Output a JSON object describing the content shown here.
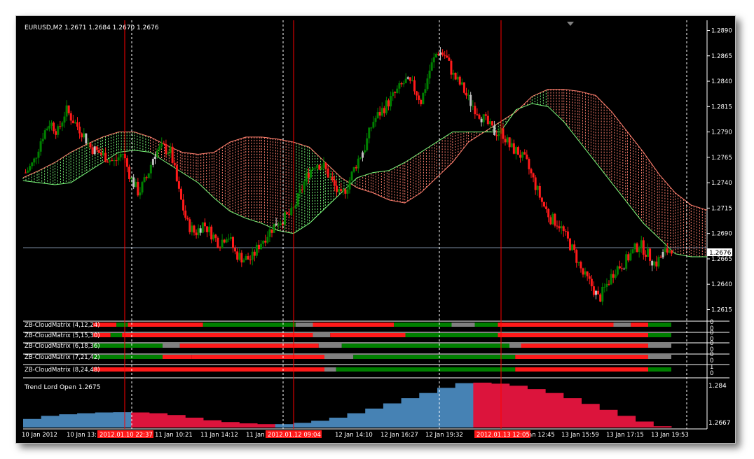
{
  "window": {
    "symbol_header": "EURUSD,M2  1.2671  1.2684  1.2670  1.2676"
  },
  "colors": {
    "background": "#000000",
    "bull_candle": "#008000",
    "bear_candle": "#ff1a1a",
    "neutral_candle": "#c0c0c0",
    "cloud_bull": "#7cfc7c",
    "cloud_bear": "#ff7f6e",
    "matrix_green": "#008000",
    "matrix_red": "#ff1a1a",
    "matrix_gray": "#808080",
    "trend_blue": "#4682b4",
    "trend_red": "#dc143c",
    "vline_red": "#ff0000"
  },
  "price_axis": {
    "ticks": [
      "1.2890",
      "1.2865",
      "1.2840",
      "1.2815",
      "1.2790",
      "1.2765",
      "1.2740",
      "1.2715",
      "1.2690",
      "1.2665",
      "1.2640",
      "1.2615"
    ],
    "current_price": "1.2676"
  },
  "matrix_panels": [
    {
      "label": "ZB-CloudMatrix (4,12,24)",
      "scale_top": "0",
      "scale_bottom": "0"
    },
    {
      "label": "ZB-CloudMatrix (5,15,30)",
      "scale_top": "0",
      "scale_bottom": "0"
    },
    {
      "label": "ZB-CloudMatrix (6,18,36)",
      "scale_top": "0",
      "scale_bottom": "0"
    },
    {
      "label": "ZB-CloudMatrix (7,21,42)",
      "scale_top": "0",
      "scale_bottom": "0"
    },
    {
      "label": "ZB-CloudMatrix (8,24,48)",
      "scale_top": "1",
      "scale_bottom": "0"
    }
  ],
  "trend_panel": {
    "label": "Trend Lord Open 1.2675",
    "scale_top": "1.284",
    "scale_bottom": "1.2667"
  },
  "time_axis": {
    "labels": [
      "10 Jan 2012",
      "10 Jan 13:",
      "11 Jan 10:21",
      "11 Jan 14:12",
      "11 Jan",
      "12 Jan 14:10",
      "12 Jan 16:27",
      "12 Jan 19:32",
      "13 Jan 12:45",
      "13 Jan 15:59",
      "13 Jan 17:15",
      "13 Jan 19:53"
    ],
    "highlights": [
      "2012.01.10 22:37",
      "2012.01.12 09:04",
      "2012.01.13 12:05"
    ]
  },
  "chart_data": {
    "type": "candlestick",
    "symbol": "EURUSD",
    "timeframe": "M2",
    "ohlc_header": {
      "open": 1.2671,
      "high": 1.2684,
      "low": 1.267,
      "close": 1.2676
    },
    "ylim": [
      1.2605,
      1.29
    ],
    "current_price": 1.2676,
    "price_path": [
      1.275,
      1.276,
      1.2785,
      1.28,
      1.279,
      1.2812,
      1.28,
      1.279,
      1.2775,
      1.277,
      1.2765,
      1.276,
      1.277,
      1.2745,
      1.273,
      1.2745,
      1.277,
      1.2775,
      1.277,
      1.273,
      1.27,
      1.269,
      1.27,
      1.269,
      1.268,
      1.269,
      1.267,
      1.2665,
      1.2665,
      1.268,
      1.269,
      1.27,
      1.2705,
      1.271,
      1.273,
      1.275,
      1.276,
      1.2755,
      1.274,
      1.2725,
      1.274,
      1.276,
      1.2775,
      1.28,
      1.281,
      1.282,
      1.283,
      1.284,
      1.2835,
      1.282,
      1.285,
      1.287,
      1.2865,
      1.2845,
      1.2835,
      1.282,
      1.281,
      1.28,
      1.279,
      1.279,
      1.2775,
      1.277,
      1.276,
      1.274,
      1.272,
      1.2705,
      1.27,
      1.2685,
      1.267,
      1.265,
      1.264,
      1.2625,
      1.264,
      1.2655,
      1.266,
      1.267,
      1.268,
      1.267,
      1.266,
      1.267,
      1.2676
    ],
    "cloud_upper": [
      1.2745,
      1.2752,
      1.276,
      1.277,
      1.2778,
      1.2785,
      1.279,
      1.279,
      1.2785,
      1.2777,
      1.277,
      1.2768,
      1.277,
      1.278,
      1.2785,
      1.2785,
      1.2783,
      1.278,
      1.2775,
      1.276,
      1.2745,
      1.2735,
      1.273,
      1.2723,
      1.272,
      1.273,
      1.2745,
      1.276,
      1.278,
      1.279,
      1.28,
      1.281,
      1.2825,
      1.2832,
      1.2832,
      1.283,
      1.2826,
      1.281,
      1.279,
      1.277,
      1.2748,
      1.273,
      1.2718,
      1.2713
    ],
    "cloud_lower": [
      1.2742,
      1.274,
      1.2738,
      1.274,
      1.275,
      1.276,
      1.277,
      1.2772,
      1.277,
      1.276,
      1.275,
      1.274,
      1.2725,
      1.2712,
      1.2705,
      1.27,
      1.2693,
      1.269,
      1.27,
      1.2715,
      1.273,
      1.2745,
      1.275,
      1.2752,
      1.276,
      1.277,
      1.278,
      1.279,
      1.279,
      1.279,
      1.279,
      1.2812,
      1.2818,
      1.2815,
      1.28,
      1.278,
      1.276,
      1.274,
      1.272,
      1.27,
      1.2685,
      1.267,
      1.2667,
      1.2667
    ],
    "trend_lord": [
      1.27,
      1.2712,
      1.2718,
      1.2722,
      1.2725,
      1.2726,
      1.2725,
      1.2722,
      1.2715,
      1.2705,
      1.2695,
      1.2688,
      1.2683,
      1.268,
      1.268,
      1.2685,
      1.2693,
      1.2705,
      1.2722,
      1.274,
      1.276,
      1.278,
      1.28,
      1.282,
      1.2838,
      1.284,
      1.2836,
      1.2828,
      1.2815,
      1.28,
      1.278,
      1.2758,
      1.2735,
      1.2712,
      1.269,
      1.2672
    ],
    "trend_lord_color": [
      "blue",
      "blue",
      "blue",
      "blue",
      "blue",
      "blue",
      "red",
      "red",
      "red",
      "red",
      "red",
      "red",
      "red",
      "red",
      "blue",
      "blue",
      "blue",
      "blue",
      "blue",
      "blue",
      "blue",
      "blue",
      "blue",
      "blue",
      "blue",
      "red",
      "red",
      "red",
      "red",
      "red",
      "red",
      "red",
      "red",
      "red",
      "red",
      "red"
    ]
  }
}
